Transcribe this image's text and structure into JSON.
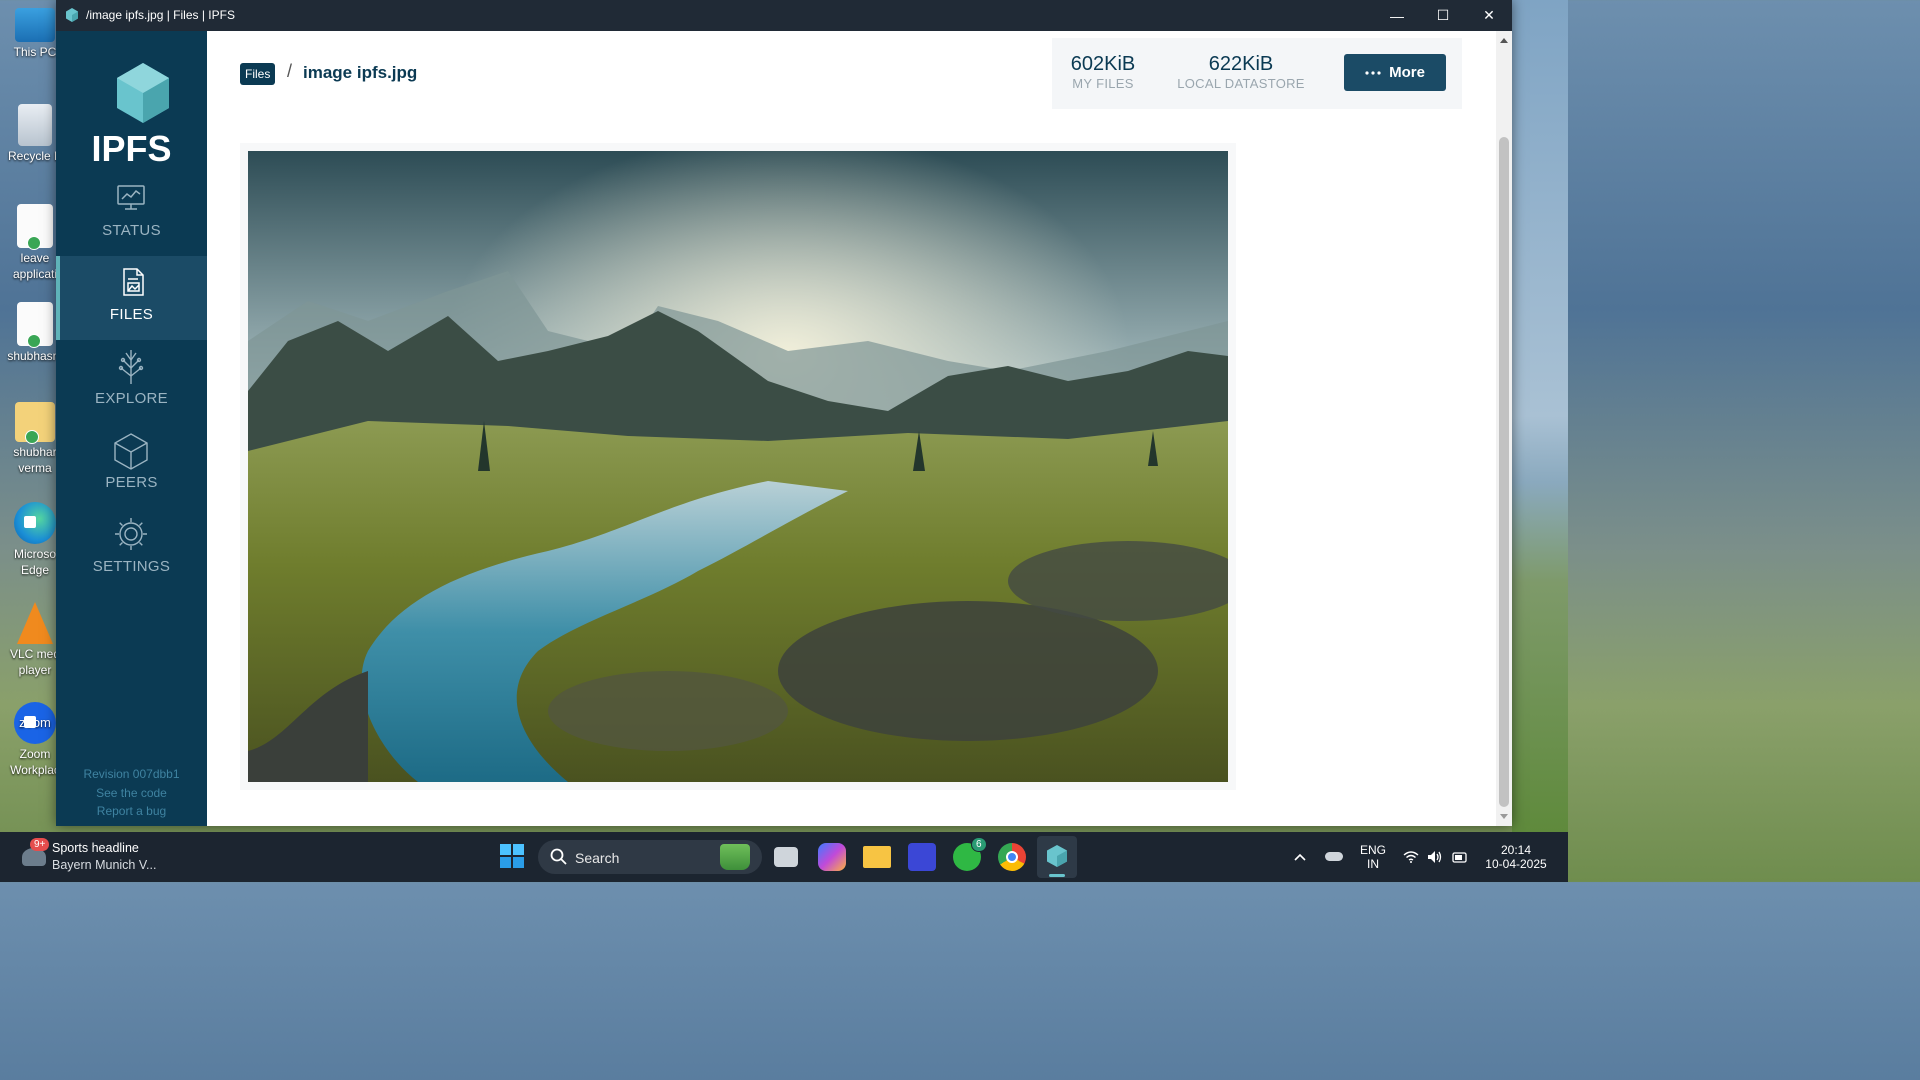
{
  "window": {
    "title": "/image ipfs.jpg | Files | IPFS",
    "controls": {
      "minimize": "—",
      "maximize": "☐",
      "close": "✕"
    }
  },
  "sidebar": {
    "logo_text": "IPFS",
    "nav": [
      {
        "label": "STATUS",
        "icon": "status-icon"
      },
      {
        "label": "FILES",
        "icon": "files-icon",
        "active": true
      },
      {
        "label": "EXPLORE",
        "icon": "explore-icon"
      },
      {
        "label": "PEERS",
        "icon": "peers-icon"
      },
      {
        "label": "SETTINGS",
        "icon": "settings-icon"
      }
    ],
    "footer": {
      "revision": "Revision 007dbb1",
      "code_link": "See the code",
      "bug_link": "Report a bug"
    }
  },
  "breadcrumb": {
    "root": "Files",
    "separator": "/",
    "current": "image ipfs.jpg"
  },
  "stats": {
    "my_files_value": "602KiB",
    "my_files_label": "MY FILES",
    "datastore_value": "622KiB",
    "datastore_label": "LOCAL DATASTORE"
  },
  "more_button": {
    "label": "More",
    "icon": "dots-icon"
  },
  "desktop": {
    "icons": [
      {
        "label": "This PC"
      },
      {
        "label": "Recycle B"
      },
      {
        "label": "leave\napplicati"
      },
      {
        "label": "shubhasm"
      },
      {
        "label": "shubhar\nverma"
      },
      {
        "label": "Microso\nEdge"
      },
      {
        "label": "VLC med\nplayer"
      },
      {
        "label": "Zoom\nWorkplac"
      }
    ]
  },
  "taskbar": {
    "news_badge": "9+",
    "news_title": "Sports headline",
    "news_subtitle": "Bayern Munich V...",
    "search_placeholder": "Search",
    "whatsapp_badge": "6",
    "language_line1": "ENG",
    "language_line2": "IN",
    "time": "20:14",
    "date": "10-04-2025"
  },
  "colors": {
    "sidebar_bg": "#0b3a53",
    "accent": "#1b4b66",
    "teal": "#69c4cd"
  }
}
